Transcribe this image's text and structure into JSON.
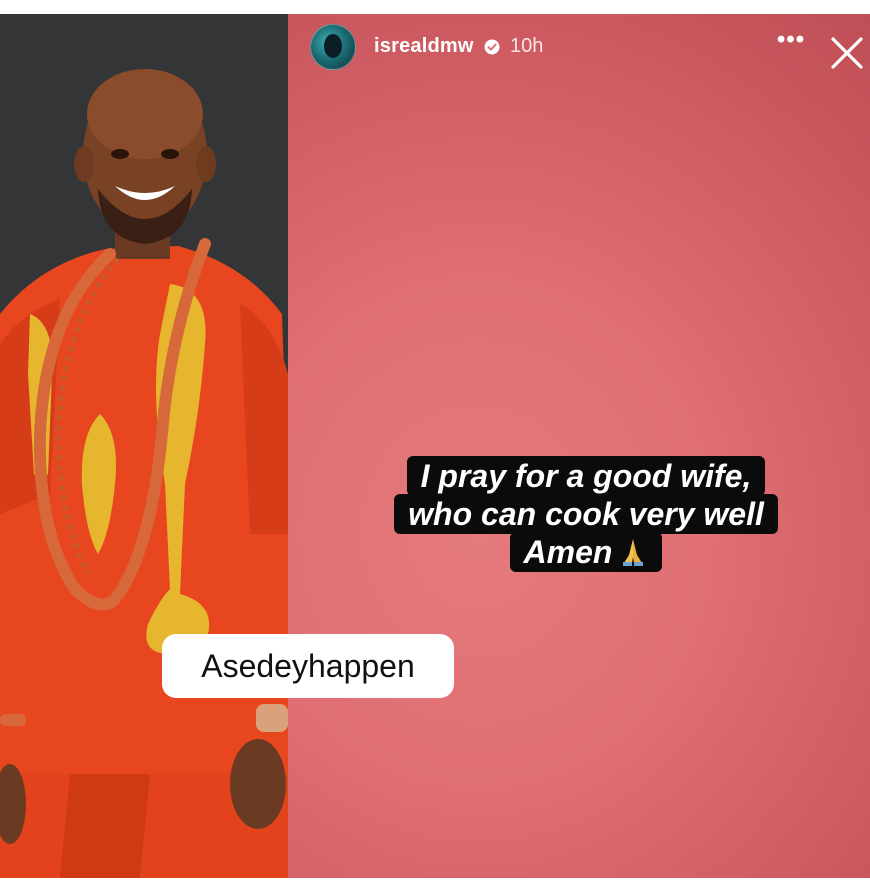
{
  "story": {
    "username": "isrealdmw",
    "verified_icon": "verified-badge-icon",
    "time_ago": "10h",
    "more_label": "•••",
    "close_icon": "close-icon",
    "caption_lines": [
      "I pray for a good wife,",
      "who can cook very well",
      "Amen"
    ],
    "caption_emoji": "folded-hands-icon",
    "watermark": "Asedeyhappen",
    "background_color": "#df6f73",
    "caption_bg_color": "#0b0b0b"
  }
}
